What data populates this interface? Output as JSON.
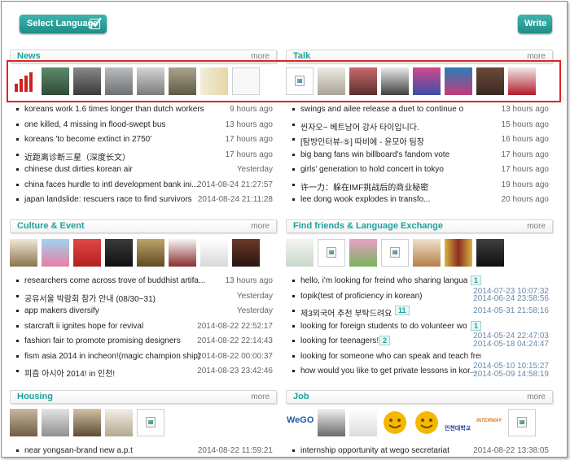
{
  "header": {
    "select_language": "Select Language",
    "write": "Write"
  },
  "more_label": "more",
  "colors": {
    "accent": "#1aa29c",
    "highlight_box": "#e02424"
  },
  "panels": {
    "news": {
      "title": "News",
      "items": [
        {
          "text": "koreans work 1.6 times longer than dutch workers",
          "date": "9 hours ago"
        },
        {
          "text": "one killed, 4 missing in flood-swept bus",
          "date": "13 hours ago"
        },
        {
          "text": "koreans 'to become extinct in 2750'",
          "date": "17 hours ago"
        },
        {
          "text": "近距离诊断三星（深度长文）",
          "date": "17 hours ago"
        },
        {
          "text": "chinese dust dirties korean air",
          "date": "Yesterday"
        },
        {
          "text": "china faces hurdle to intl development bank ini...",
          "date": "2014-08-24 21:27:57"
        },
        {
          "text": "japan landslide: rescuers race to find survivors",
          "date": "2014-08-24 21:11:28"
        }
      ]
    },
    "talk": {
      "title": "Talk",
      "items": [
        {
          "text": "swings and ailee release a duet to continue on t...",
          "date": "13 hours ago"
        },
        {
          "text": "씬자오~ 베트남어 강사 타이입니다.",
          "date": "15 hours ago"
        },
        {
          "text": "[탐방인터뷰-⑤] 따비에 - 윤모아 팀장",
          "date": "16 hours ago"
        },
        {
          "text": "big bang fans win billboard's fandom vote",
          "date": "17 hours ago"
        },
        {
          "text": "girls' generation to hold concert in tokyo",
          "date": "17 hours ago"
        },
        {
          "text": "许一力：躲在IMF挑战后的商业秘密",
          "date": "19 hours ago"
        },
        {
          "text": "lee dong wook explodes in transfo...",
          "date": "20 hours ago"
        }
      ]
    },
    "culture": {
      "title": "Culture & Event",
      "items": [
        {
          "text": "researchers come across trove of buddhist artifa...",
          "date": "13 hours ago"
        },
        {
          "text": "공유서울 박람회 참가 안내 (08/30~31)",
          "date": "Yesterday"
        },
        {
          "text": "app makers diversify",
          "date": "Yesterday"
        },
        {
          "text": "starcraft ii ignites hope for revival",
          "date": "2014-08-22 22:52:17"
        },
        {
          "text": "fashion fair to promote promising designers",
          "date": "2014-08-22 22:14:43"
        },
        {
          "text": "fism asia 2014 in incheon!(magic champion ship)",
          "date": "2014-08-22 00:00:37"
        },
        {
          "text": "피즘 아시아 2014! in 인천!",
          "date": "2014-08-23 23:42:46"
        }
      ]
    },
    "friends": {
      "title": "Find friends & Language Exchange",
      "items": [
        {
          "text": "hello, i'm looking for freind who sharing langua...",
          "badge": "1",
          "date_top": "",
          "date_bottom": ""
        },
        {
          "text": "topik(test of proficiency in korean)",
          "badge": "",
          "date_top": "2014-07-23 10:07:32",
          "date_bottom": "2014-06-24 23:58:56"
        },
        {
          "text": "제3외국어 추천 부탁드려요",
          "badge": "11",
          "date_top": "",
          "date_bottom": "2014-05-31 21:58:16"
        },
        {
          "text": "looking for foreign students to do volunteer wor...",
          "badge": "1",
          "date_top": "",
          "date_bottom": ""
        },
        {
          "text": "looking for teenagers!",
          "badge": "2",
          "date_top": "2014-05-24 22:47:03",
          "date_bottom": "2014-05-18 04:24:47"
        },
        {
          "text": "looking for someone who can speak and teach fren...",
          "badge": "",
          "date_top": "",
          "date_bottom": ""
        },
        {
          "text": "how would you like to get private lessons in kor...",
          "badge": "",
          "date_top": "2014-05-10 10:15:27",
          "date_bottom": "2014-05-09 14:58:19"
        }
      ]
    },
    "housing": {
      "title": "Housing",
      "items": [
        {
          "text": "near yongsan-brand new a.p.t",
          "date": "2014-08-22 11:59:21"
        }
      ]
    },
    "job": {
      "title": "Job",
      "items": [
        {
          "text": "internship opportunity at wego secretariat",
          "date": "2014-08-22 13:38:05"
        }
      ],
      "logo_texts": [
        "WeGO",
        "인천대학교",
        "INTERWAY"
      ]
    }
  }
}
